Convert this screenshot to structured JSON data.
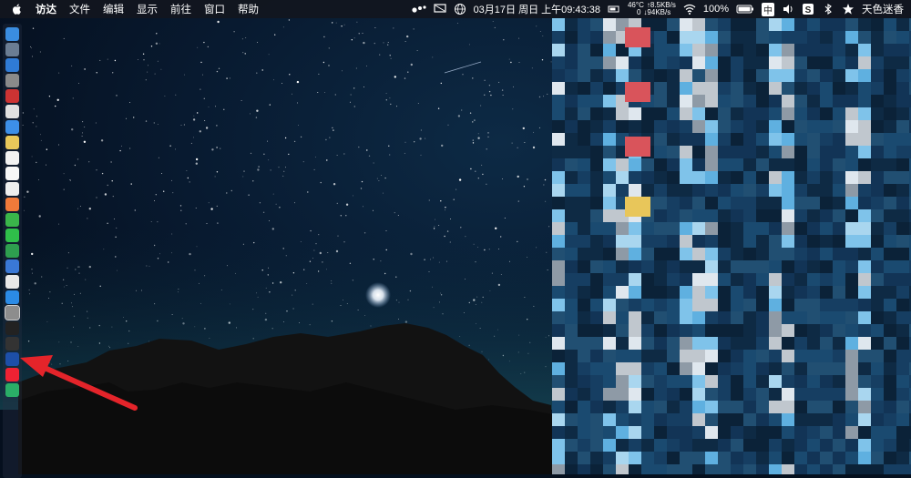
{
  "menubar": {
    "apple_icon": "apple-logo-icon",
    "items": [
      "访达",
      "文件",
      "编辑",
      "显示",
      "前往",
      "窗口",
      "帮助"
    ],
    "status": {
      "temperature": "46°C",
      "upload": "↑8.5KB/s",
      "zero": "0",
      "download": "↓94KB/s",
      "datetime": "03月17日 周日 上午09:43:38",
      "battery_percent": "100%",
      "input_method": "中",
      "user": "天色迷香"
    }
  },
  "dock": {
    "apps": [
      "finder",
      "launchpad",
      "safari",
      "rocket",
      "calendar-mini",
      "preview",
      "safari-compass",
      "notes",
      "ical",
      "reminders",
      "textedit",
      "photos",
      "messages",
      "facetime",
      "numbers",
      "keynote",
      "itunes",
      "app-store",
      "system-preferences",
      "terminal",
      "activity-monitor",
      "vpn",
      "yandex",
      "wechat"
    ]
  },
  "colors": {
    "menubar_bg": "#12161e",
    "sky": "#081a30",
    "arrow": "#e4242a",
    "pixel_blue": "#4fa3d8"
  }
}
